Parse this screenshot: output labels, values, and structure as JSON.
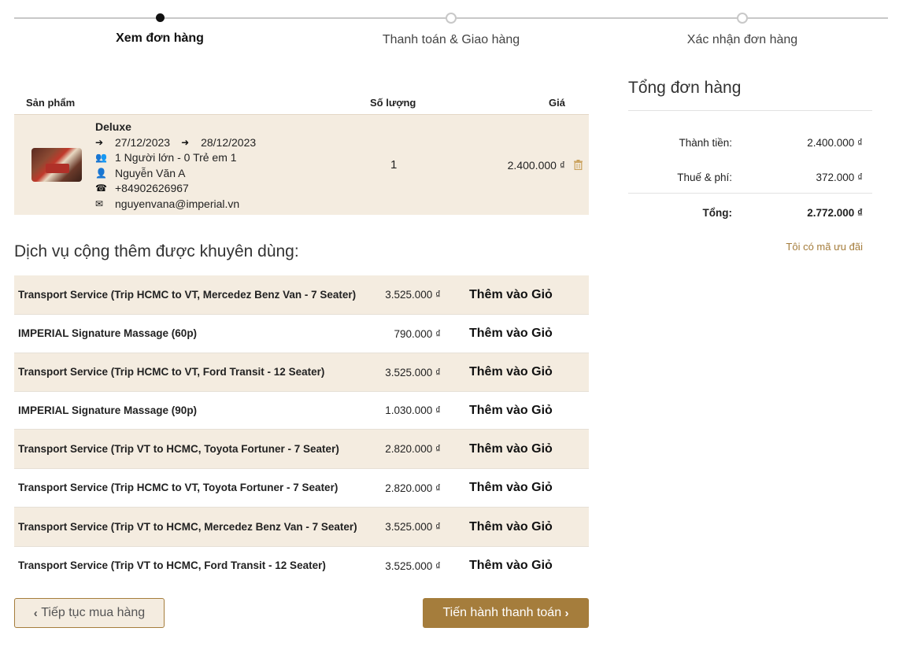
{
  "steps": [
    {
      "label": "Xem đơn hàng"
    },
    {
      "label": "Thanh toán & Giao hàng"
    },
    {
      "label": "Xác nhận đơn hàng"
    }
  ],
  "cart": {
    "headers": {
      "product": "Sản phẩm",
      "qty": "Số lượng",
      "price": "Giá"
    },
    "item": {
      "name": "Deluxe",
      "checkin": "27/12/2023",
      "checkout": "28/12/2023",
      "guests": "1 Người lớn - 0 Trẻ em 1",
      "customer": "Nguyễn Văn A",
      "phone": "+84902626967",
      "email": "nguyenvana@imperial.vn",
      "qty": "1",
      "price": "2.400.000 ₫"
    }
  },
  "summary": {
    "title": "Tổng đơn hàng",
    "subtotal_label": "Thành tiền:",
    "subtotal": "2.400.000 ₫",
    "tax_label": "Thuế & phí:",
    "tax": "372.000 ₫",
    "total_label": "Tổng:",
    "total": "2.772.000 ₫",
    "promo": "Tôi có mã ưu đãi"
  },
  "services_title": "Dịch vụ cộng thêm được khuyên dùng:",
  "add_label": "Thêm vào Giỏ",
  "services": [
    {
      "name": "Transport Service (Trip HCMC to VT, Mercedez Benz Van - 7 Seater)",
      "price": "3.525.000 ₫"
    },
    {
      "name": "IMPERIAL Signature Massage (60p)",
      "price": "790.000 ₫"
    },
    {
      "name": "Transport Service (Trip HCMC to VT, Ford Transit - 12 Seater)",
      "price": "3.525.000 ₫"
    },
    {
      "name": "IMPERIAL Signature Massage (90p)",
      "price": "1.030.000 ₫"
    },
    {
      "name": "Transport Service (Trip VT to HCMC, Toyota Fortuner - 7 Seater)",
      "price": "2.820.000 ₫"
    },
    {
      "name": "Transport Service (Trip HCMC to VT, Toyota Fortuner - 7 Seater)",
      "price": "2.820.000 ₫"
    },
    {
      "name": "Transport Service (Trip VT to HCMC, Mercedez Benz Van - 7 Seater)",
      "price": "3.525.000 ₫"
    },
    {
      "name": "Transport Service (Trip VT to HCMC, Ford Transit - 12 Seater)",
      "price": "3.525.000 ₫"
    }
  ],
  "buttons": {
    "continue": "Tiếp tục mua hàng",
    "checkout": "Tiến hành thanh toán"
  },
  "colors": {
    "accent": "#a57d3c",
    "row_bg": "#f4ece0"
  }
}
